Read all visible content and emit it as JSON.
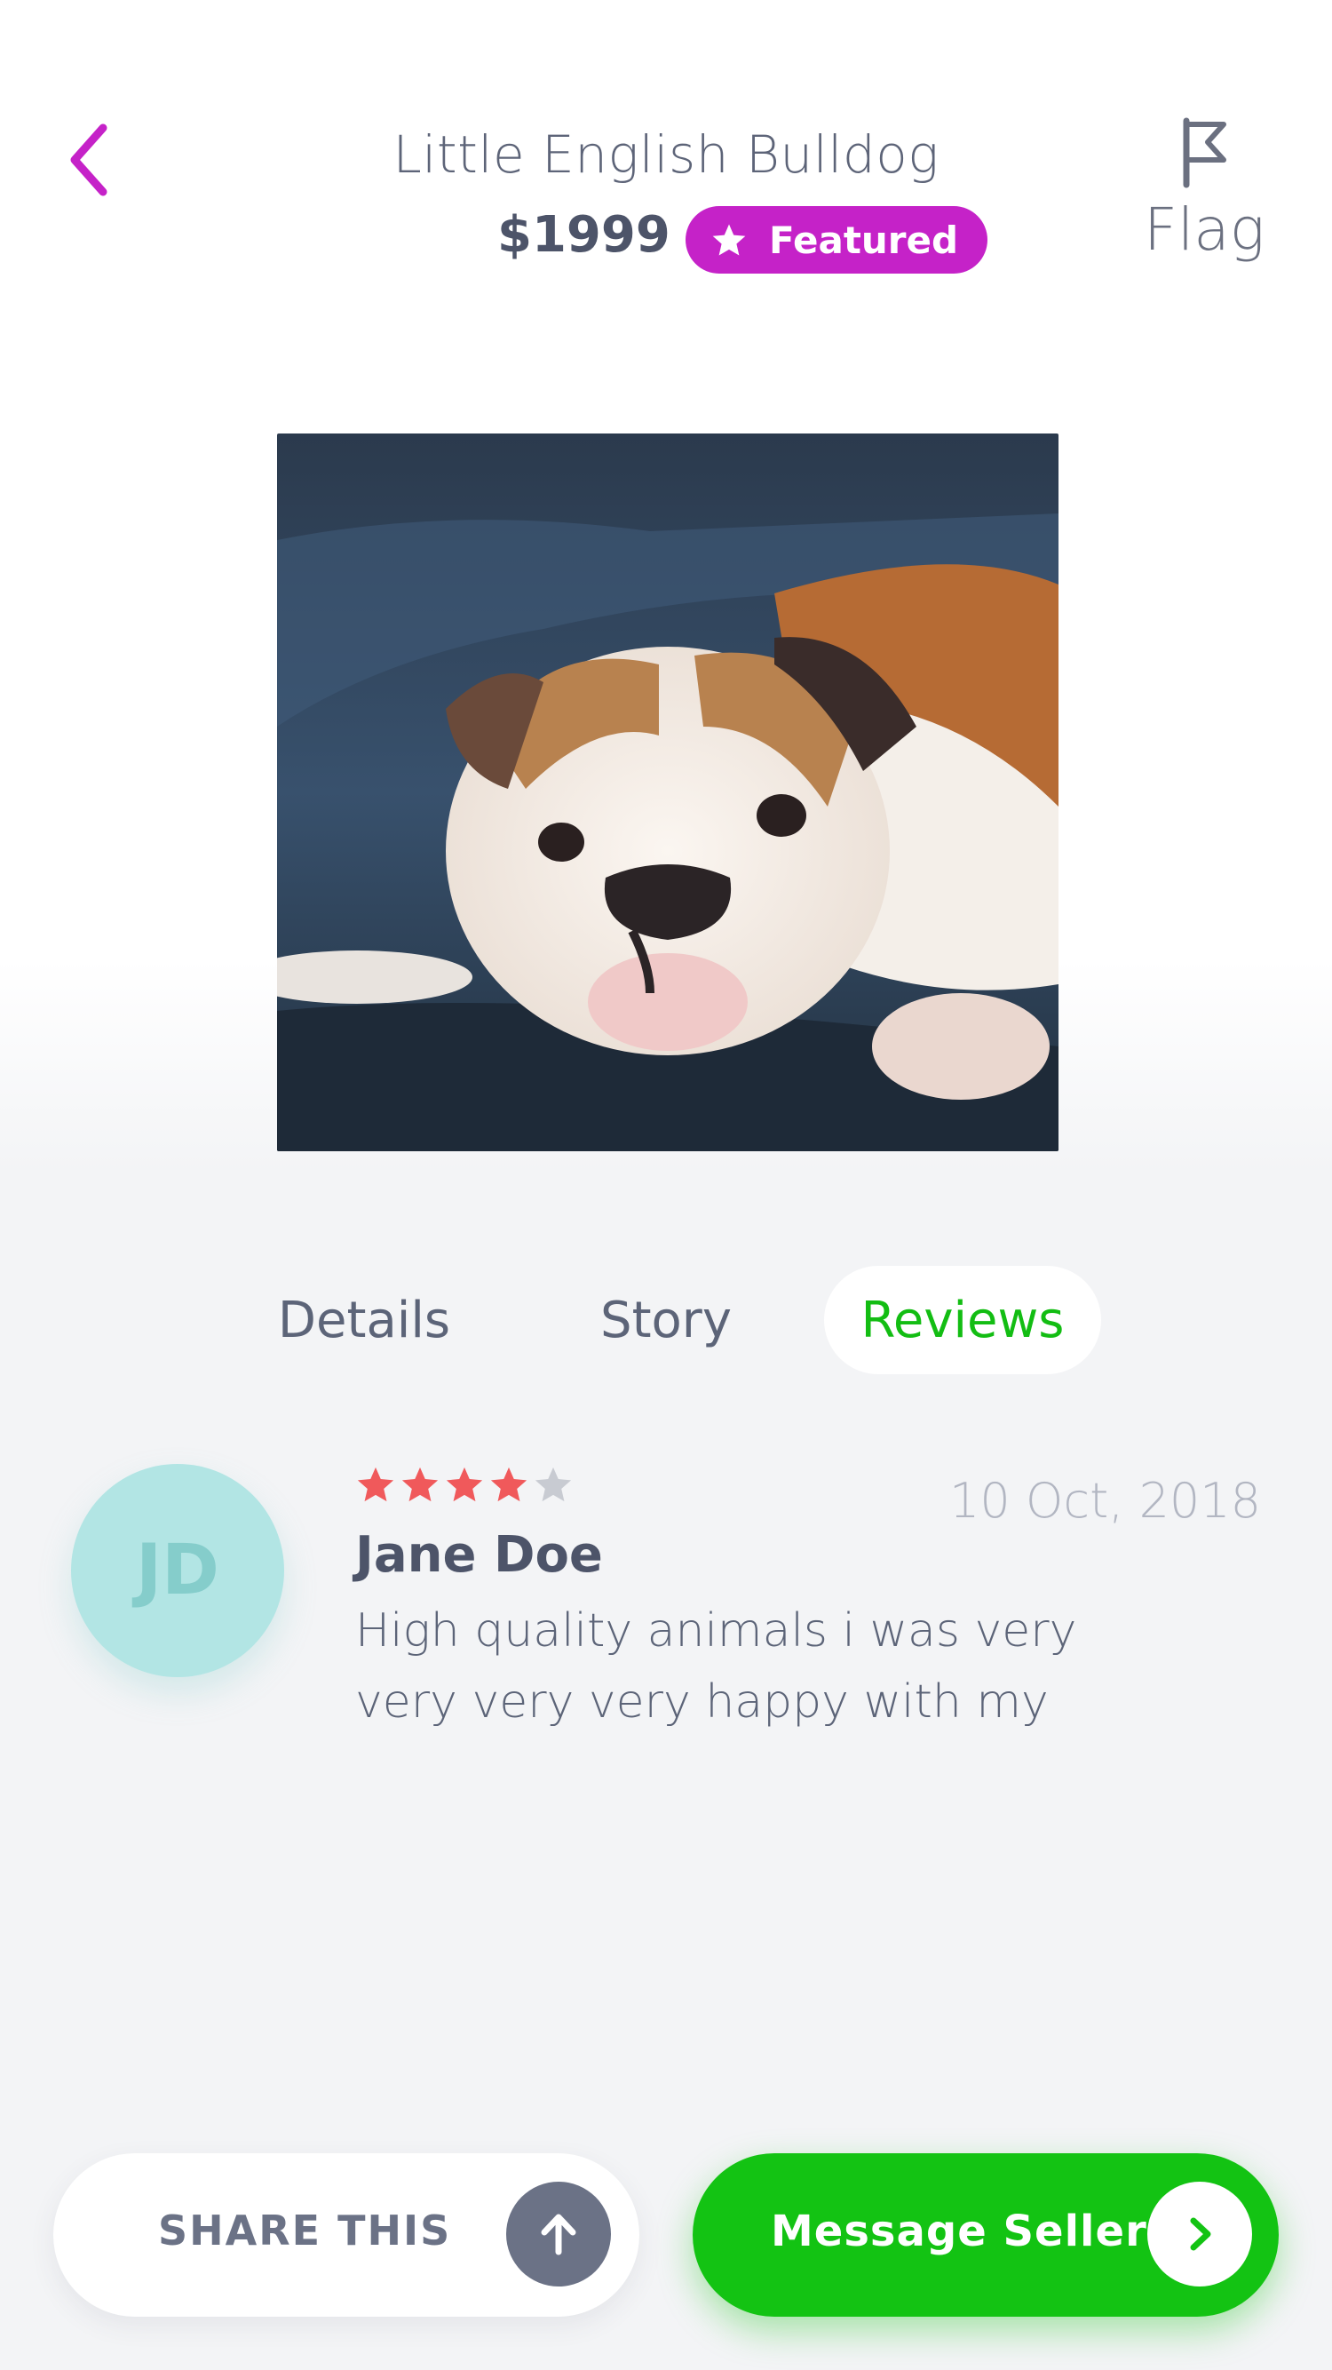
{
  "header": {
    "title": "Little English Bulldog",
    "price": "$1999",
    "featured_label": "Featured",
    "flag_label": "Flag"
  },
  "tabs": [
    {
      "label": "Details",
      "active": false
    },
    {
      "label": "Story",
      "active": false
    },
    {
      "label": "Reviews",
      "active": true
    }
  ],
  "review": {
    "initials": "JD",
    "rating": 4,
    "max_rating": 5,
    "date": "10 Oct, 2018",
    "reviewer": "Jane Doe",
    "text_line1": "High quality animals i was very",
    "text_line2": "very very very happy with my"
  },
  "actions": {
    "share_label": "SHARE THIS",
    "message_label": "Message Seller"
  },
  "icons": {
    "back": "chevron-left-icon",
    "flag": "flag-icon",
    "featured": "star-icon",
    "share": "arrow-up-icon",
    "message": "chevron-right-icon"
  },
  "colors": {
    "accent": "#c522c8",
    "primary_green": "#13c313",
    "star_filled": "#f0595b",
    "star_empty": "#c8cbd2",
    "avatar_bg": "#b2e5e4"
  }
}
